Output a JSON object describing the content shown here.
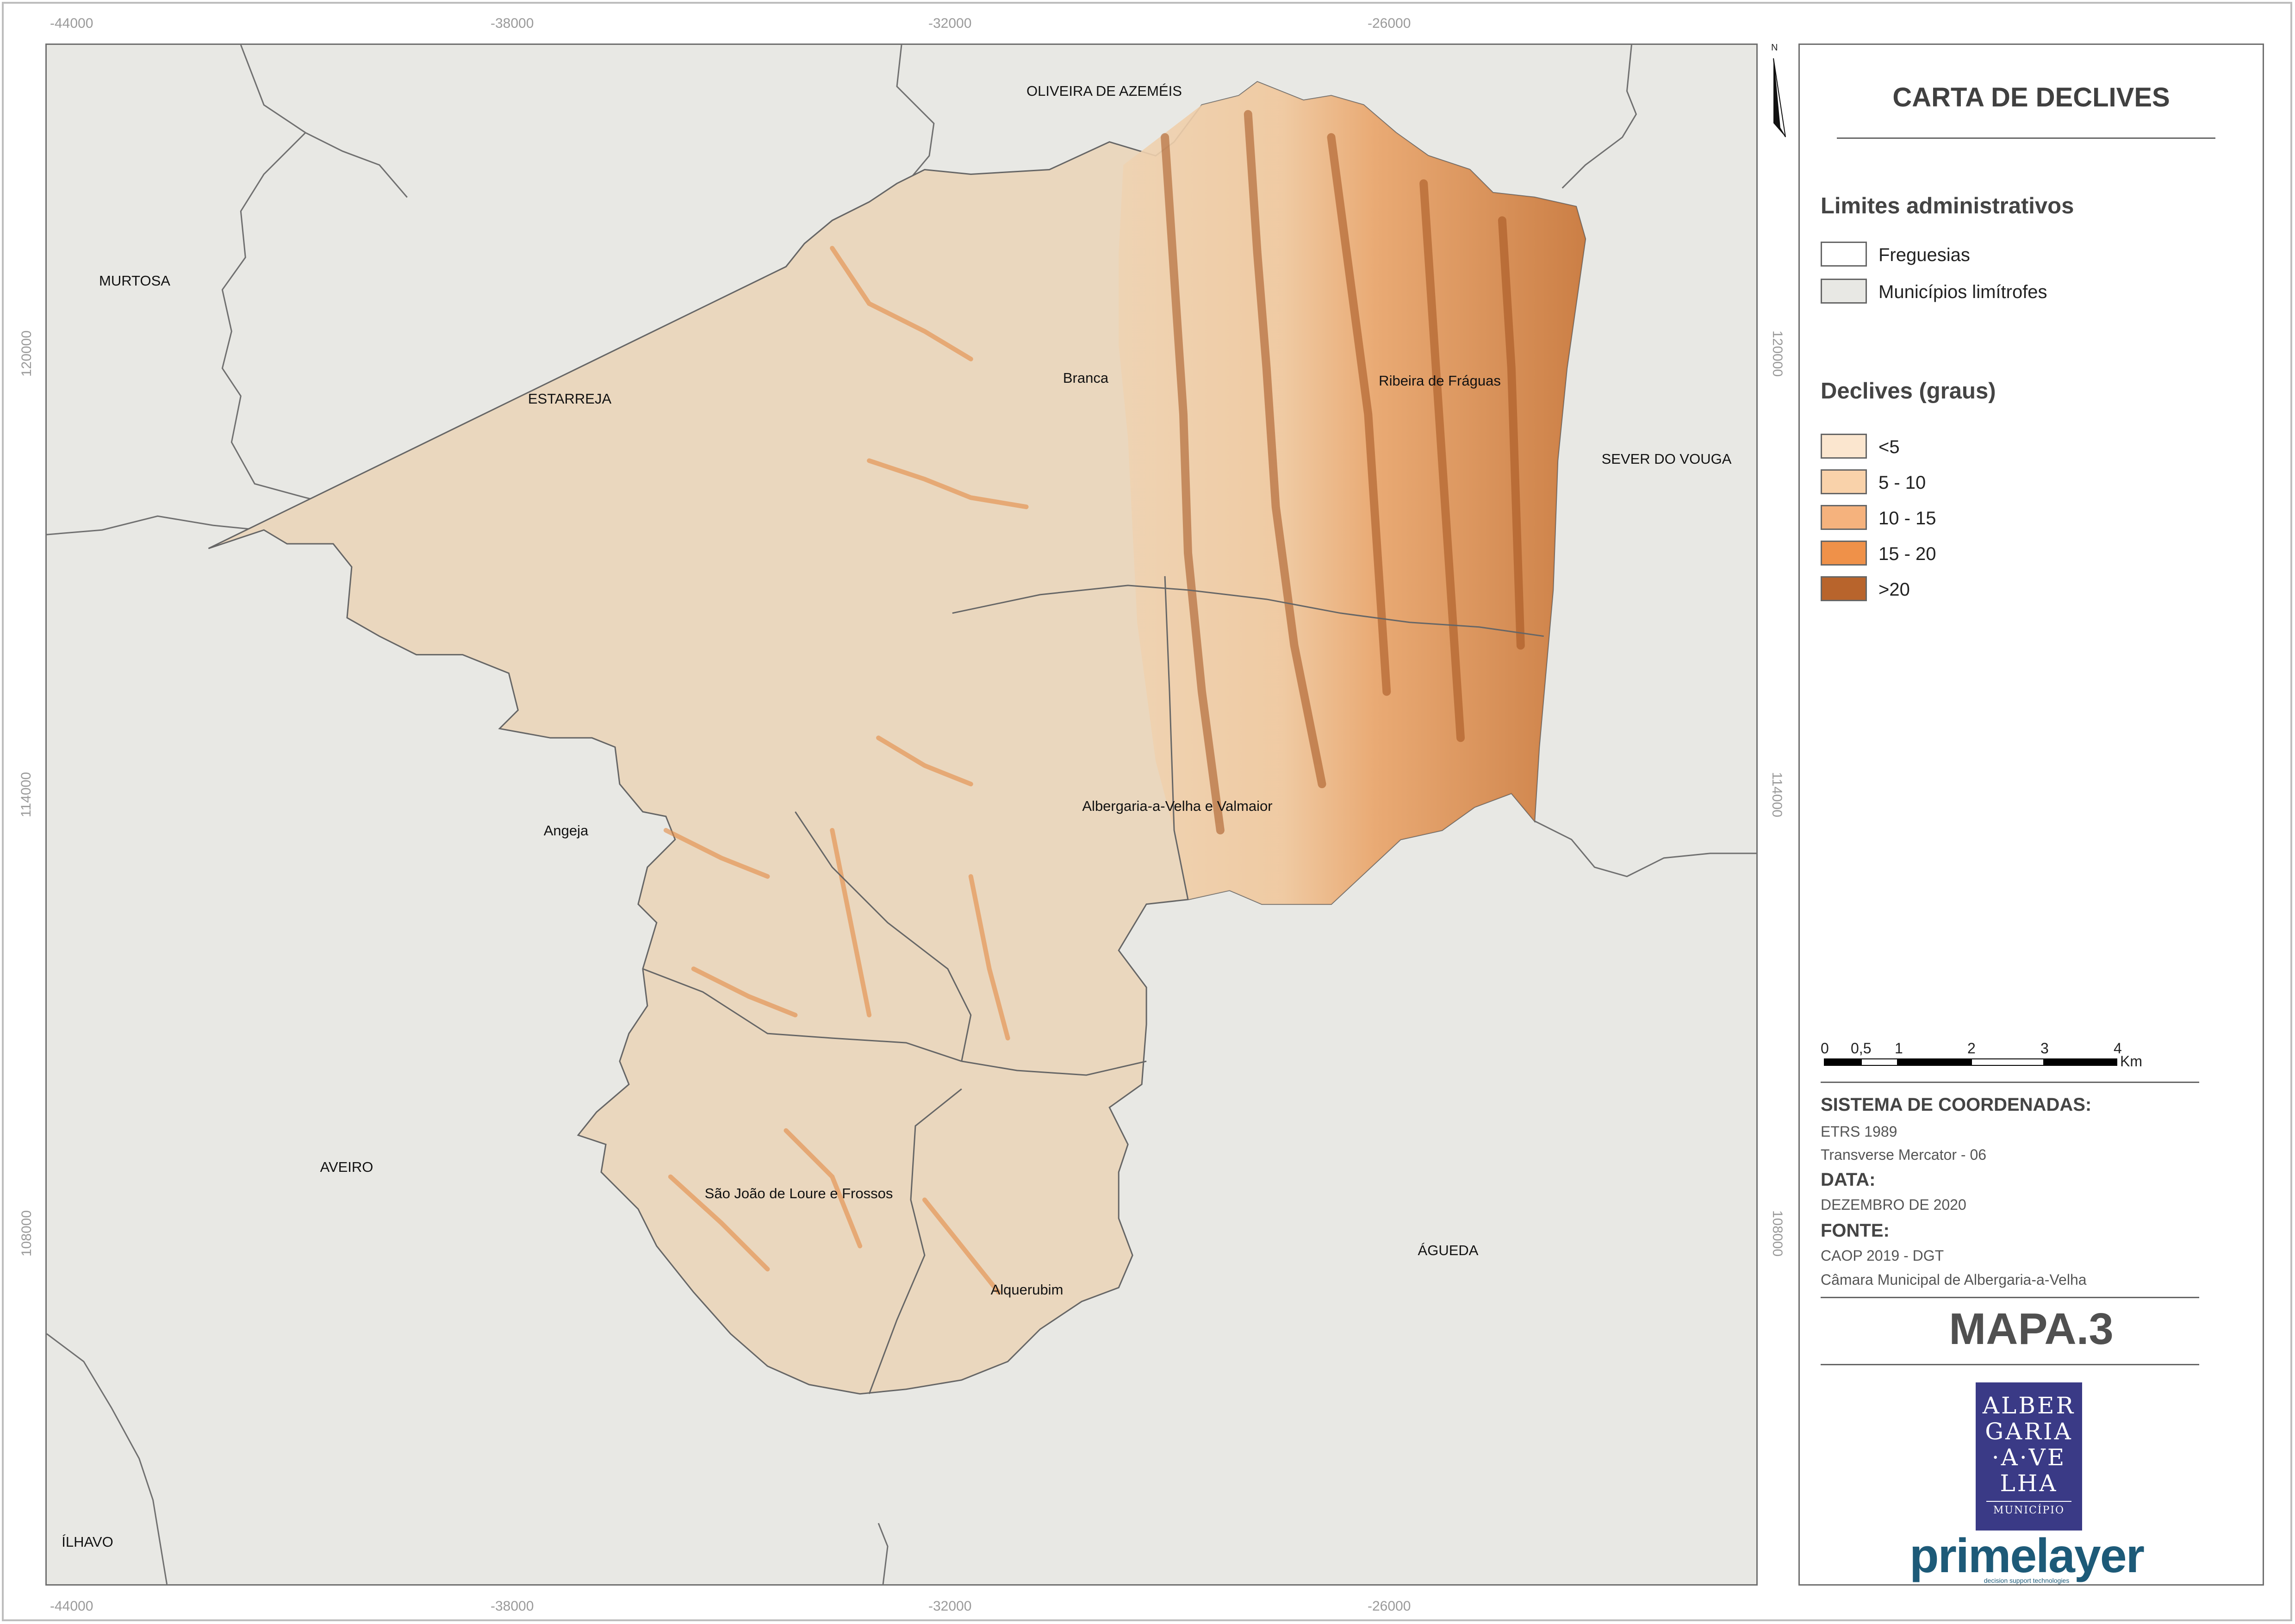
{
  "title": "CARTA DE DECLIVES",
  "legend": {
    "admin_heading": "Limites administrativos",
    "admin_items": [
      {
        "label": "Freguesias",
        "color": "#ffffff"
      },
      {
        "label": "Municípios limítrofes",
        "color": "#e8e8e4"
      }
    ],
    "slope_heading": "Declives (graus)",
    "slope_classes": [
      {
        "label": "<5",
        "color": "#fbe6cf"
      },
      {
        "label": "5 - 10",
        "color": "#f9d2aa"
      },
      {
        "label": "10 - 15",
        "color": "#f5b27d"
      },
      {
        "label": "15 - 20",
        "color": "#ef9149"
      },
      {
        "label": ">20",
        "color": "#b8642c"
      }
    ]
  },
  "scale_bar": {
    "ticks": [
      "0",
      "0,5",
      "1",
      "2",
      "3",
      "4"
    ],
    "unit": "Km"
  },
  "metadata": {
    "coord_heading": "SISTEMA DE COORDENADAS:",
    "coord_lines": [
      "ETRS 1989",
      "Transverse Mercator - 06"
    ],
    "date_heading": "DATA:",
    "date_value": "DEZEMBRO DE 2020",
    "source_heading": "FONTE:",
    "source_lines": [
      "CAOP 2019 - DGT",
      "Câmara Municipal de Albergaria-a-Velha"
    ]
  },
  "map_id": "MAPA.3",
  "logos": {
    "municipality_lines": [
      "ALBER",
      "GARIA",
      "·A·VE",
      "LHA"
    ],
    "municipality_sub": "MUNICÍPIO",
    "company": "primelayer",
    "company_sub": "decision support technologies"
  },
  "north_arrow": "N",
  "grid": {
    "x_ticks": [
      "-44000",
      "-38000",
      "-32000",
      "-26000"
    ],
    "y_ticks": [
      "120000",
      "114000",
      "108000"
    ]
  },
  "places": {
    "neighbors": [
      "OLIVEIRA DE AZEMÉIS",
      "MURTOSA",
      "ESTARREJA",
      "SEVER DO VOUGA",
      "AVEIRO",
      "ÁGUEDA",
      "ÍLHAVO"
    ],
    "parishes": [
      "Branca",
      "Ribeira de Fráguas",
      "Angeja",
      "Albergaria-a-Velha e Valmaior",
      "São João de Loure e Frossos",
      "Alquerubim"
    ]
  },
  "colors": {
    "map_background": "#e8e8e4",
    "municipality_fill": "#ead7be",
    "panel_border": "#6f6f6f"
  }
}
